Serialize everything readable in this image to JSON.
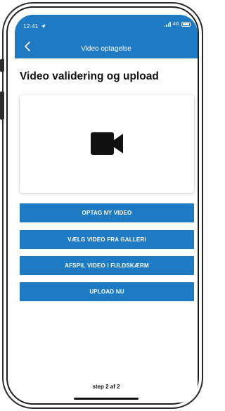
{
  "status_bar": {
    "time": "12.41",
    "network": "4G"
  },
  "nav": {
    "title": "Video optagelse"
  },
  "page": {
    "heading": "Video validering og upload",
    "step_text": "step 2 af 2"
  },
  "buttons": {
    "record": "OPTAG NY VIDEO",
    "gallery": "VÆLG VIDEO FRA GALLERI",
    "play": "AFSPIL VIDEO I FULDSKÆRM",
    "upload": "UPLOAD NU"
  },
  "icons": {
    "back": "chevron-left-icon",
    "camera": "video-camera-icon",
    "location": "location-arrow-icon"
  },
  "colors": {
    "primary": "#1e7ac2",
    "text": "#111111",
    "background": "#ffffff"
  }
}
